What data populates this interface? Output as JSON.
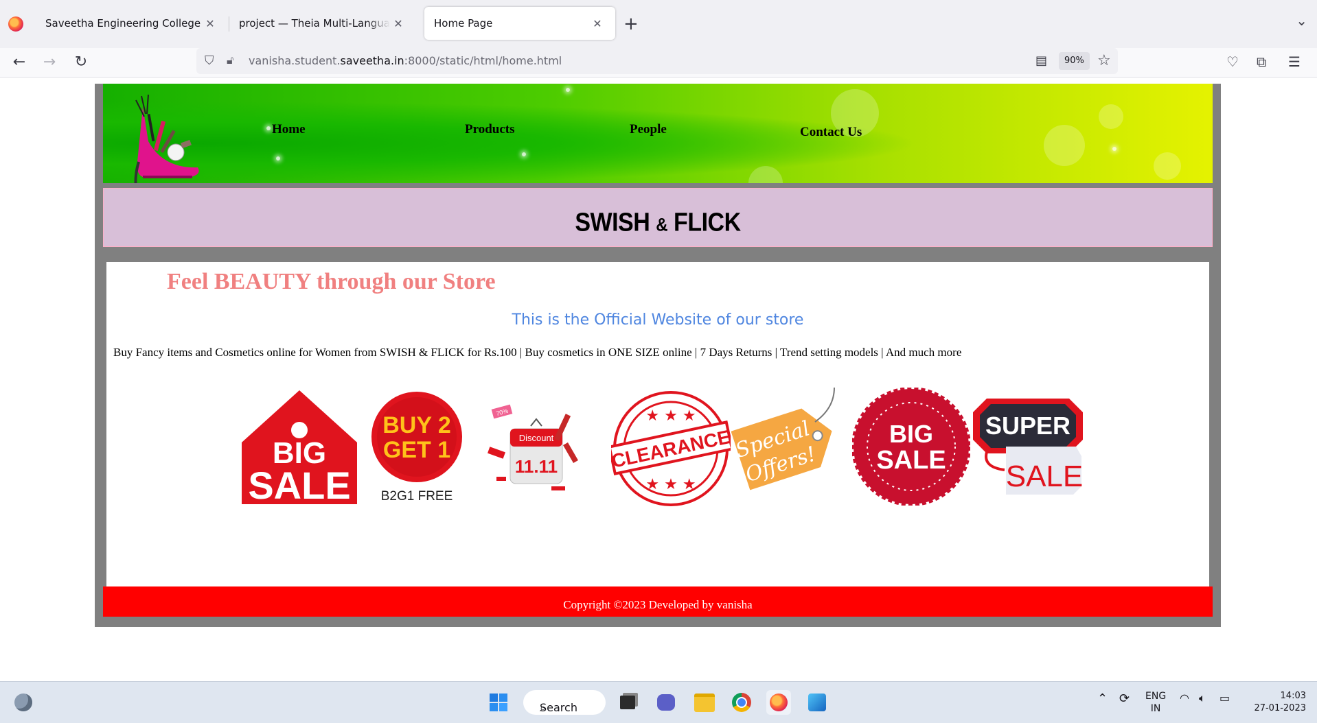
{
  "browser": {
    "tabs": [
      {
        "title": "Saveetha Engineering College",
        "active": false
      },
      {
        "title": "project — Theia Multi-Language Ex",
        "active": false
      },
      {
        "title": "Home Page",
        "active": true
      }
    ],
    "url_prefix": "vanisha.student.",
    "url_domain": "saveetha.in",
    "url_suffix": ":8000/static/html/home.html",
    "zoom": "90%"
  },
  "page": {
    "nav": {
      "home": "Home",
      "products": "Products",
      "people": "People",
      "contact": "Contact Us"
    },
    "brand_left": "SWISH",
    "brand_amp": "&",
    "brand_right": "FLICK",
    "tagline": "Feel BEAUTY through our Store",
    "official": "This is the Official Website of our store",
    "description": "Buy Fancy items and Cosmetics online for Women from SWISH & FLICK for Rs.100 | Buy cosmetics in ONE SIZE online | 7 Days Returns | Trend setting models | And much more",
    "badges": {
      "big_sale_tag": [
        "BIG",
        "SALE"
      ],
      "buy2get1": [
        "BUY 2",
        "GET 1"
      ],
      "b2g1_caption": "B2G1 FREE",
      "discount_label": "Discount",
      "discount_date": "11.11",
      "discount_percent": "70%",
      "clearance": "CLEARANCE",
      "special_offers": [
        "Special",
        "Offers!"
      ],
      "big_sale_seal": [
        "BIG",
        "SALE"
      ],
      "super_sale": [
        "SUPER",
        "SALE"
      ]
    },
    "footer": "Copyright ©2023 Developed by vanisha"
  },
  "taskbar": {
    "search": "Search",
    "lang_top": "ENG",
    "lang_bottom": "IN",
    "time": "14:03",
    "date": "27-01-2023"
  },
  "colors": {
    "banner_green": "#15b000",
    "banner_yellow": "#e5f200",
    "title_bg": "#d8bfd8",
    "tagline": "#f08080",
    "official": "#4f86e0",
    "footer": "#ff0000",
    "badge_red": "#e0141e"
  }
}
